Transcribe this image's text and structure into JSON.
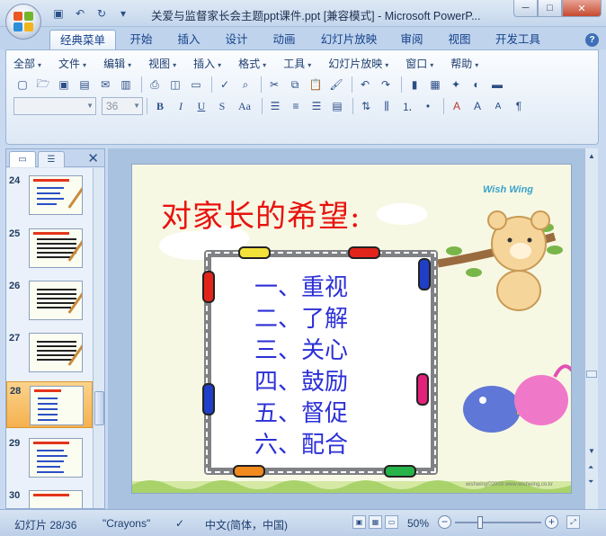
{
  "window": {
    "title": "关爱与监督家长会主题ppt课件.ppt [兼容模式] - Microsoft PowerP...",
    "minimize": "─",
    "maximize": "□",
    "close": "✕"
  },
  "quick_access": [
    "save-icon",
    "undo-icon",
    "redo-icon",
    "customize-icon"
  ],
  "ribbon_tabs": [
    {
      "label": "经典菜单",
      "active": true
    },
    {
      "label": "开始"
    },
    {
      "label": "插入"
    },
    {
      "label": "设计"
    },
    {
      "label": "动画"
    },
    {
      "label": "幻灯片放映"
    },
    {
      "label": "审阅"
    },
    {
      "label": "视图"
    },
    {
      "label": "开发工具"
    }
  ],
  "help": "?",
  "menu": [
    "全部",
    "文件",
    "编辑",
    "视图",
    "插入",
    "格式",
    "工具",
    "幻灯片放映",
    "窗口",
    "帮助"
  ],
  "font": {
    "name": "",
    "size": "36"
  },
  "format_buttons": {
    "bold": "B",
    "italic": "I",
    "underline": "U",
    "shadow": "S",
    "case": "Aa"
  },
  "panel": {
    "close": "✕"
  },
  "thumbnails": [
    {
      "num": "24"
    },
    {
      "num": "25"
    },
    {
      "num": "26"
    },
    {
      "num": "27"
    },
    {
      "num": "28",
      "selected": true
    },
    {
      "num": "29"
    },
    {
      "num": "30"
    }
  ],
  "slide": {
    "title": "对家长的希望:",
    "items": [
      "一、重视",
      "二、了解",
      "三、关心",
      "四、鼓励",
      "五、督促",
      "六、配合"
    ],
    "wish_logo": "Wish Wing",
    "footer": "wishwing©2003 www.wishwing.co.kr"
  },
  "status": {
    "slide_info": "幻灯片 28/36",
    "theme": "\"Crayons\"",
    "language": "中文(简体，中国)",
    "zoom": "50%",
    "zoom_fraction": 0.29
  },
  "colors": {
    "title_red": "#e8130f",
    "item_blue": "#2b2fd6",
    "selected_thumb": "#f5b14f"
  }
}
